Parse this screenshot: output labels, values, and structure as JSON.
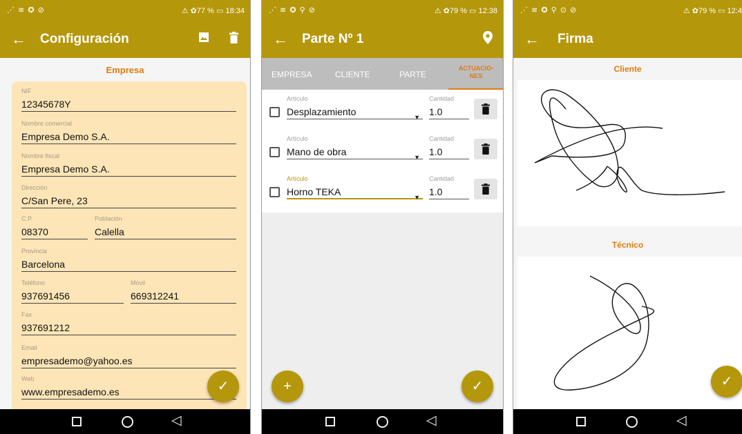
{
  "screens": [
    {
      "status": {
        "signals": "⋰ ≋ ✪ ⊘",
        "right": "⚠ ✿77 % ▭ 18:34"
      },
      "appbar": {
        "back": "←",
        "title": "Configuración"
      },
      "section": "Empresa",
      "fields": {
        "nif": {
          "label": "NIF",
          "value": "12345678Y"
        },
        "nombre_comercial": {
          "label": "Nombre comercial",
          "value": "Empresa Demo S.A."
        },
        "nombre_fiscal": {
          "label": "Nombre fiscal",
          "value": "Empresa Demo S.A."
        },
        "direccion": {
          "label": "Dirección",
          "value": "C/San Pere, 23"
        },
        "cp": {
          "label": "C.P.",
          "value": "08370"
        },
        "poblacion": {
          "label": "Población",
          "value": "Calella"
        },
        "provincia": {
          "label": "Provincia",
          "value": "Barcelona"
        },
        "telefono": {
          "label": "Teléfono",
          "value": "937691456"
        },
        "movil": {
          "label": "Móvil",
          "value": "669312241"
        },
        "fax": {
          "label": "Fax",
          "value": "937691212"
        },
        "email": {
          "label": "Email",
          "value": "empresademo@yahoo.es"
        },
        "web": {
          "label": "Web",
          "value": "www.empresademo.es"
        }
      },
      "fab": "✓"
    },
    {
      "status": {
        "signals": "⋰ ≋ ✪ ⚲ ⊘",
        "right": "⚠ ✿79 % ▭ 12:38"
      },
      "appbar": {
        "back": "←",
        "title": "Parte Nº 1"
      },
      "tabs": [
        {
          "label": "EMPRESA"
        },
        {
          "label": "CLIENTE"
        },
        {
          "label": "PARTE"
        },
        {
          "label": "ACTUACIO-\nNES",
          "active": true
        }
      ],
      "rows": [
        {
          "article_label": "Artículo",
          "article": "Desplazamiento",
          "qty_label": "Cantidad",
          "qty": "1.0"
        },
        {
          "article_label": "Artículo",
          "article": "Mano de obra",
          "qty_label": "Cantidad",
          "qty": "1.0"
        },
        {
          "article_label": "Artículo",
          "article": "Horno TEKA",
          "qty_label": "Cantidad",
          "qty": "1.0"
        }
      ],
      "fab_add": "+",
      "fab": "✓"
    },
    {
      "status": {
        "signals": "⋰ ≋ ✪ ⚲ ⊙ ⊘",
        "right": "⚠ ✿79 % ▭ 12:4"
      },
      "appbar": {
        "back": "←",
        "title": "Firma"
      },
      "signatures": {
        "cliente": "Cliente",
        "tecnico": "Técnico"
      },
      "fab": "✓"
    }
  ],
  "navbar": {
    "home": "○",
    "back": "◁"
  },
  "colors": {
    "appbar": "#b5970b",
    "accent": "#e07b0e",
    "card": "#fde5b7"
  }
}
